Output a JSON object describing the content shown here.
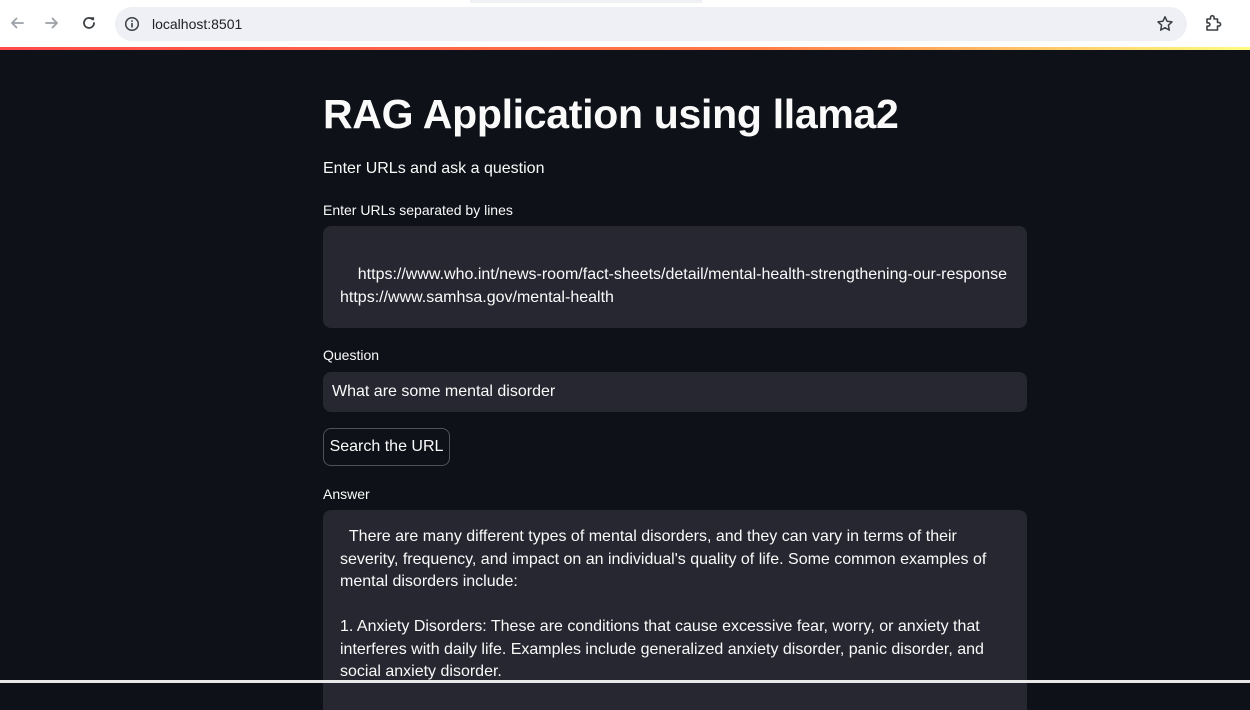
{
  "browser": {
    "url": "localhost:8501",
    "icons": {
      "back": "arrow-left-icon",
      "forward": "arrow-right-icon",
      "reload": "reload-icon",
      "site_info": "info-circle-icon",
      "bookmark": "star-icon",
      "extensions": "puzzle-icon"
    }
  },
  "app": {
    "title": "RAG Application using llama2",
    "subtitle": "Enter URLs and ask a question",
    "urls_label": "Enter URLs separated by lines",
    "urls_value": "https://www.who.int/news-room/fact-sheets/detail/mental-health-strengthening-our-response\nhttps://www.samhsa.gov/mental-health",
    "question_label": "Question",
    "question_value": "What are some mental disorder",
    "search_button_label": "Search the URL",
    "answer_label": "Answer",
    "answer_value": "  There are many different types of mental disorders, and they can vary in terms of their severity, frequency, and impact on an individual's quality of life. Some common examples of mental disorders include:\n\n1. Anxiety Disorders: These are conditions that cause excessive fear, worry, or anxiety that interferes with daily life. Examples include generalized anxiety disorder, panic disorder, and social anxiety disorder."
  },
  "colors": {
    "background": "#0e1117",
    "input_background": "#262730",
    "text": "#fafafa",
    "accent_gradient_start": "#ff4b4b",
    "accent_gradient_end": "#fffd80"
  }
}
